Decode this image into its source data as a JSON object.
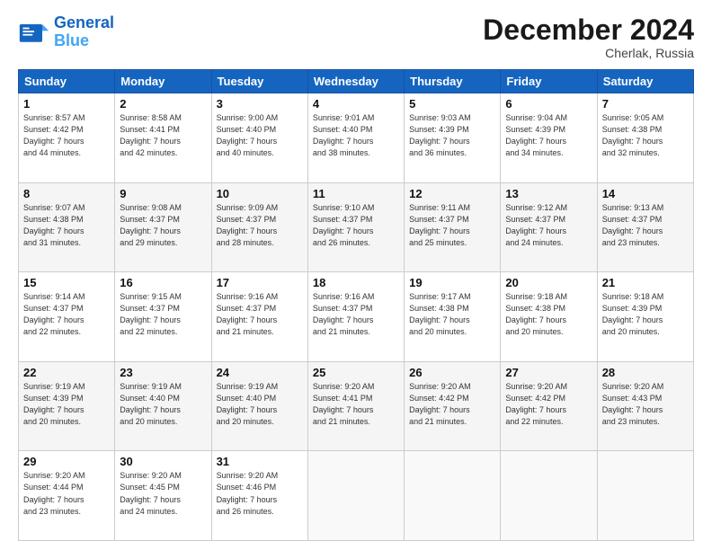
{
  "header": {
    "logo_line1": "General",
    "logo_line2": "Blue",
    "month": "December 2024",
    "location": "Cherlak, Russia"
  },
  "days_of_week": [
    "Sunday",
    "Monday",
    "Tuesday",
    "Wednesday",
    "Thursday",
    "Friday",
    "Saturday"
  ],
  "weeks": [
    [
      {
        "day": "1",
        "lines": [
          "Sunrise: 8:57 AM",
          "Sunset: 4:42 PM",
          "Daylight: 7 hours",
          "and 44 minutes."
        ]
      },
      {
        "day": "2",
        "lines": [
          "Sunrise: 8:58 AM",
          "Sunset: 4:41 PM",
          "Daylight: 7 hours",
          "and 42 minutes."
        ]
      },
      {
        "day": "3",
        "lines": [
          "Sunrise: 9:00 AM",
          "Sunset: 4:40 PM",
          "Daylight: 7 hours",
          "and 40 minutes."
        ]
      },
      {
        "day": "4",
        "lines": [
          "Sunrise: 9:01 AM",
          "Sunset: 4:40 PM",
          "Daylight: 7 hours",
          "and 38 minutes."
        ]
      },
      {
        "day": "5",
        "lines": [
          "Sunrise: 9:03 AM",
          "Sunset: 4:39 PM",
          "Daylight: 7 hours",
          "and 36 minutes."
        ]
      },
      {
        "day": "6",
        "lines": [
          "Sunrise: 9:04 AM",
          "Sunset: 4:39 PM",
          "Daylight: 7 hours",
          "and 34 minutes."
        ]
      },
      {
        "day": "7",
        "lines": [
          "Sunrise: 9:05 AM",
          "Sunset: 4:38 PM",
          "Daylight: 7 hours",
          "and 32 minutes."
        ]
      }
    ],
    [
      {
        "day": "8",
        "lines": [
          "Sunrise: 9:07 AM",
          "Sunset: 4:38 PM",
          "Daylight: 7 hours",
          "and 31 minutes."
        ]
      },
      {
        "day": "9",
        "lines": [
          "Sunrise: 9:08 AM",
          "Sunset: 4:37 PM",
          "Daylight: 7 hours",
          "and 29 minutes."
        ]
      },
      {
        "day": "10",
        "lines": [
          "Sunrise: 9:09 AM",
          "Sunset: 4:37 PM",
          "Daylight: 7 hours",
          "and 28 minutes."
        ]
      },
      {
        "day": "11",
        "lines": [
          "Sunrise: 9:10 AM",
          "Sunset: 4:37 PM",
          "Daylight: 7 hours",
          "and 26 minutes."
        ]
      },
      {
        "day": "12",
        "lines": [
          "Sunrise: 9:11 AM",
          "Sunset: 4:37 PM",
          "Daylight: 7 hours",
          "and 25 minutes."
        ]
      },
      {
        "day": "13",
        "lines": [
          "Sunrise: 9:12 AM",
          "Sunset: 4:37 PM",
          "Daylight: 7 hours",
          "and 24 minutes."
        ]
      },
      {
        "day": "14",
        "lines": [
          "Sunrise: 9:13 AM",
          "Sunset: 4:37 PM",
          "Daylight: 7 hours",
          "and 23 minutes."
        ]
      }
    ],
    [
      {
        "day": "15",
        "lines": [
          "Sunrise: 9:14 AM",
          "Sunset: 4:37 PM",
          "Daylight: 7 hours",
          "and 22 minutes."
        ]
      },
      {
        "day": "16",
        "lines": [
          "Sunrise: 9:15 AM",
          "Sunset: 4:37 PM",
          "Daylight: 7 hours",
          "and 22 minutes."
        ]
      },
      {
        "day": "17",
        "lines": [
          "Sunrise: 9:16 AM",
          "Sunset: 4:37 PM",
          "Daylight: 7 hours",
          "and 21 minutes."
        ]
      },
      {
        "day": "18",
        "lines": [
          "Sunrise: 9:16 AM",
          "Sunset: 4:37 PM",
          "Daylight: 7 hours",
          "and 21 minutes."
        ]
      },
      {
        "day": "19",
        "lines": [
          "Sunrise: 9:17 AM",
          "Sunset: 4:38 PM",
          "Daylight: 7 hours",
          "and 20 minutes."
        ]
      },
      {
        "day": "20",
        "lines": [
          "Sunrise: 9:18 AM",
          "Sunset: 4:38 PM",
          "Daylight: 7 hours",
          "and 20 minutes."
        ]
      },
      {
        "day": "21",
        "lines": [
          "Sunrise: 9:18 AM",
          "Sunset: 4:39 PM",
          "Daylight: 7 hours",
          "and 20 minutes."
        ]
      }
    ],
    [
      {
        "day": "22",
        "lines": [
          "Sunrise: 9:19 AM",
          "Sunset: 4:39 PM",
          "Daylight: 7 hours",
          "and 20 minutes."
        ]
      },
      {
        "day": "23",
        "lines": [
          "Sunrise: 9:19 AM",
          "Sunset: 4:40 PM",
          "Daylight: 7 hours",
          "and 20 minutes."
        ]
      },
      {
        "day": "24",
        "lines": [
          "Sunrise: 9:19 AM",
          "Sunset: 4:40 PM",
          "Daylight: 7 hours",
          "and 20 minutes."
        ]
      },
      {
        "day": "25",
        "lines": [
          "Sunrise: 9:20 AM",
          "Sunset: 4:41 PM",
          "Daylight: 7 hours",
          "and 21 minutes."
        ]
      },
      {
        "day": "26",
        "lines": [
          "Sunrise: 9:20 AM",
          "Sunset: 4:42 PM",
          "Daylight: 7 hours",
          "and 21 minutes."
        ]
      },
      {
        "day": "27",
        "lines": [
          "Sunrise: 9:20 AM",
          "Sunset: 4:42 PM",
          "Daylight: 7 hours",
          "and 22 minutes."
        ]
      },
      {
        "day": "28",
        "lines": [
          "Sunrise: 9:20 AM",
          "Sunset: 4:43 PM",
          "Daylight: 7 hours",
          "and 23 minutes."
        ]
      }
    ],
    [
      {
        "day": "29",
        "lines": [
          "Sunrise: 9:20 AM",
          "Sunset: 4:44 PM",
          "Daylight: 7 hours",
          "and 23 minutes."
        ]
      },
      {
        "day": "30",
        "lines": [
          "Sunrise: 9:20 AM",
          "Sunset: 4:45 PM",
          "Daylight: 7 hours",
          "and 24 minutes."
        ]
      },
      {
        "day": "31",
        "lines": [
          "Sunrise: 9:20 AM",
          "Sunset: 4:46 PM",
          "Daylight: 7 hours",
          "and 26 minutes."
        ]
      },
      null,
      null,
      null,
      null
    ]
  ]
}
